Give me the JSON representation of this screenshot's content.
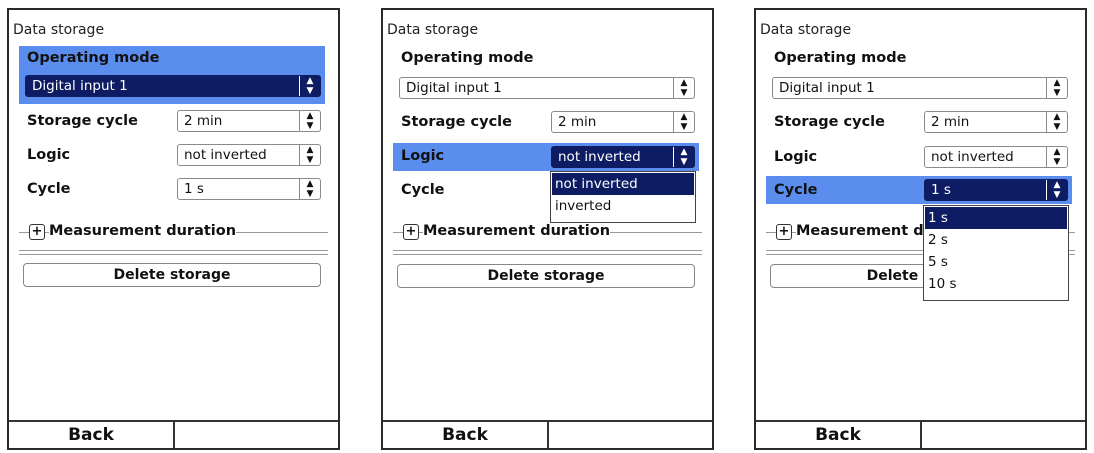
{
  "panels": [
    {
      "title": "Data storage",
      "operating_mode_label": "Operating mode",
      "operating_mode_value": "Digital input 1",
      "storage_cycle_label": "Storage cycle",
      "storage_cycle_value": "2 min",
      "logic_label": "Logic",
      "logic_value": "not inverted",
      "cycle_label": "Cycle",
      "cycle_value": "1 s",
      "measurement_duration_label": "Measurement duration",
      "delete_label": "Delete storage",
      "back_label": "Back"
    },
    {
      "title": "Data storage",
      "operating_mode_label": "Operating mode",
      "operating_mode_value": "Digital input 1",
      "storage_cycle_label": "Storage cycle",
      "storage_cycle_value": "2 min",
      "logic_label": "Logic",
      "logic_value": "not inverted",
      "logic_options": [
        "not inverted",
        "inverted"
      ],
      "cycle_label": "Cycle",
      "measurement_duration_label": "Measurement duration",
      "delete_label": "Delete storage",
      "back_label": "Back"
    },
    {
      "title": "Data storage",
      "operating_mode_label": "Operating mode",
      "operating_mode_value": "Digital input 1",
      "storage_cycle_label": "Storage cycle",
      "storage_cycle_value": "2 min",
      "logic_label": "Logic",
      "logic_value": "not inverted",
      "cycle_label": "Cycle",
      "cycle_value": "1 s",
      "cycle_options": [
        "1 s",
        "2 s",
        "5 s",
        "10 s"
      ],
      "measurement_duration_label": "Measurement du",
      "delete_label": "Delete s",
      "back_label": "Back"
    }
  ],
  "colors": {
    "highlight": "#5b8def",
    "selected": "#0d1c63"
  }
}
